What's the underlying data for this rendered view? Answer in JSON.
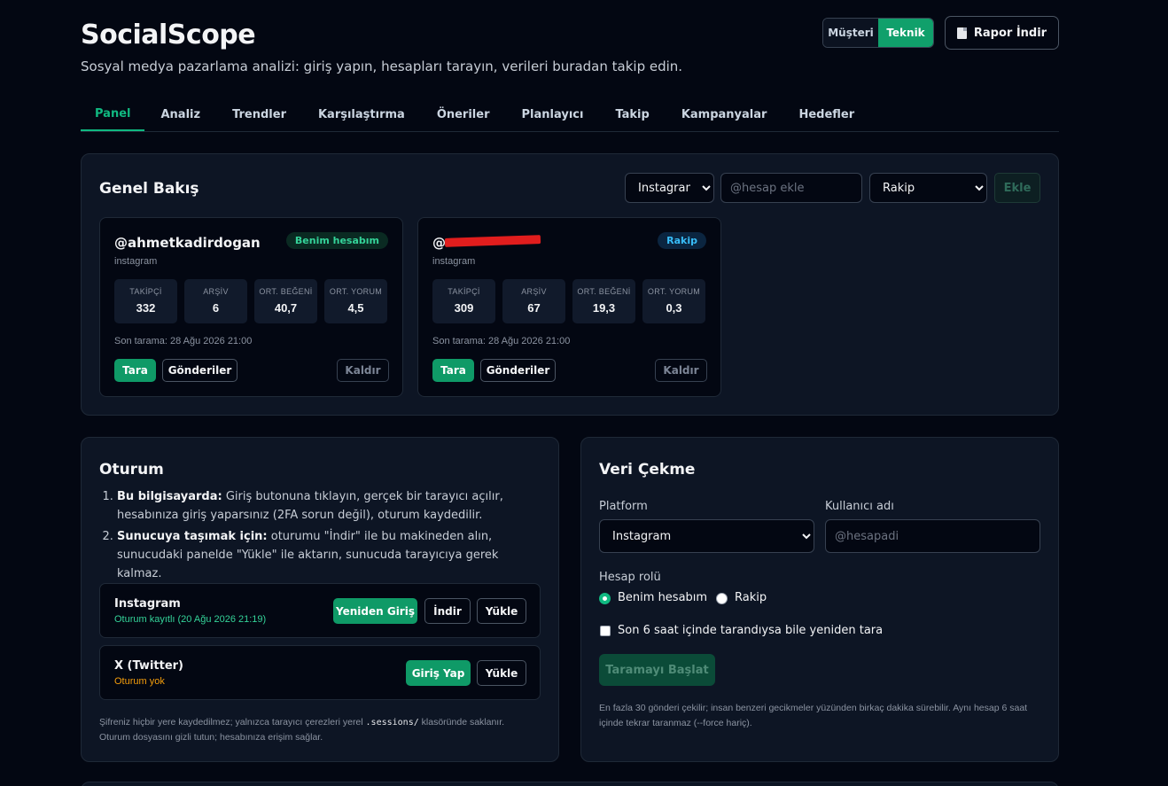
{
  "header": {
    "title": "SocialScope",
    "subtitle": "Sosyal medya pazarlama analizi: giriş yapın, hesapları tarayın, verileri buradan takip edin.",
    "mode_options": [
      "Müşteri",
      "Teknik"
    ],
    "mode_selected": "Teknik",
    "report_button": "Rapor İndir"
  },
  "tabs": [
    "Panel",
    "Analiz",
    "Trendler",
    "Karşılaştırma",
    "Öneriler",
    "Planlayıcı",
    "Takip",
    "Kampanyalar",
    "Hedefler"
  ],
  "active_tab": "Panel",
  "overview": {
    "title": "Genel Bakış",
    "platform_select": "Instagram",
    "account_placeholder": "@hesap ekle",
    "role_select": "Rakip",
    "add_button": "Ekle",
    "accounts": [
      {
        "handle": "@ahmetkadirdogan",
        "platform": "instagram",
        "badge": "Benim hesabım",
        "stats": [
          {
            "label": "TAKİPÇİ",
            "value": "332"
          },
          {
            "label": "ARŞİV",
            "value": "6"
          },
          {
            "label": "ORT. BEĞENİ",
            "value": "40,7"
          },
          {
            "label": "ORT. YORUM",
            "value": "4,5"
          }
        ],
        "last_scan": "Son tarama: 28 Ağu 2026 21:00",
        "scan_button": "Tara",
        "posts_button": "Gönderiler",
        "remove_button": "Kaldır"
      },
      {
        "handle": "@",
        "platform": "instagram",
        "badge": "Rakip",
        "stats": [
          {
            "label": "TAKİPÇİ",
            "value": "309"
          },
          {
            "label": "ARŞİV",
            "value": "67"
          },
          {
            "label": "ORT. BEĞENİ",
            "value": "19,3"
          },
          {
            "label": "ORT. YORUM",
            "value": "0,3"
          }
        ],
        "last_scan": "Son tarama: 28 Ağu 2026 21:00",
        "scan_button": "Tara",
        "posts_button": "Gönderiler",
        "remove_button": "Kaldır"
      }
    ]
  },
  "session": {
    "title": "Oturum",
    "step1_bold": "Bu bilgisayarda:",
    "step1_text": " Giriş butonuna tıklayın, gerçek bir tarayıcı açılır, hesabınıza giriş yaparsınız (2FA sorun değil), oturum kaydedilir.",
    "step2_bold": "Sunucuya taşımak için:",
    "step2_text": " oturumu \"İndir\" ile bu makineden alın, sunucudaki panelde \"Yükle\" ile aktarın, sunucuda tarayıcıya gerek kalmaz.",
    "rows": [
      {
        "name": "Instagram",
        "status": "Oturum kayıtlı (20 Ağu 2026 21:19)",
        "status_color": "#34d399",
        "buttons": [
          "Yeniden Giriş",
          "İndir",
          "Yükle"
        ]
      },
      {
        "name": "X (Twitter)",
        "status": "Oturum yok",
        "status_color": "#f59e0b",
        "buttons": [
          "Giriş Yap",
          "Yükle"
        ]
      }
    ],
    "note_1": "Şifreniz hiçbir yere kaydedilmez; yalnızca tarayıcı çerezleri yerel ",
    "note_code": ".sessions/",
    "note_2": " klasöründe saklanır. Oturum dosyasını gizli tutun; hesabınıza erişim sağlar."
  },
  "fetch": {
    "title": "Veri Çekme",
    "platform_label": "Platform",
    "platform_value": "Instagram",
    "username_label": "Kullanıcı adı",
    "username_placeholder": "@hesapadi",
    "role_label": "Hesap rolü",
    "role_options": [
      "Benim hesabım",
      "Rakip"
    ],
    "role_selected": "Benim hesabım",
    "force_label": "Son 6 saat içinde tarandıysa bile yeniden tara",
    "start_button": "Taramayı Başlat",
    "note": "En fazla 30 gönderi çekilir; insan benzeri gecikmeler yüzünden birkaç dakika sürebilir. Aynı hesap 6 saat içinde tekrar taranmaz (--force hariç)."
  }
}
